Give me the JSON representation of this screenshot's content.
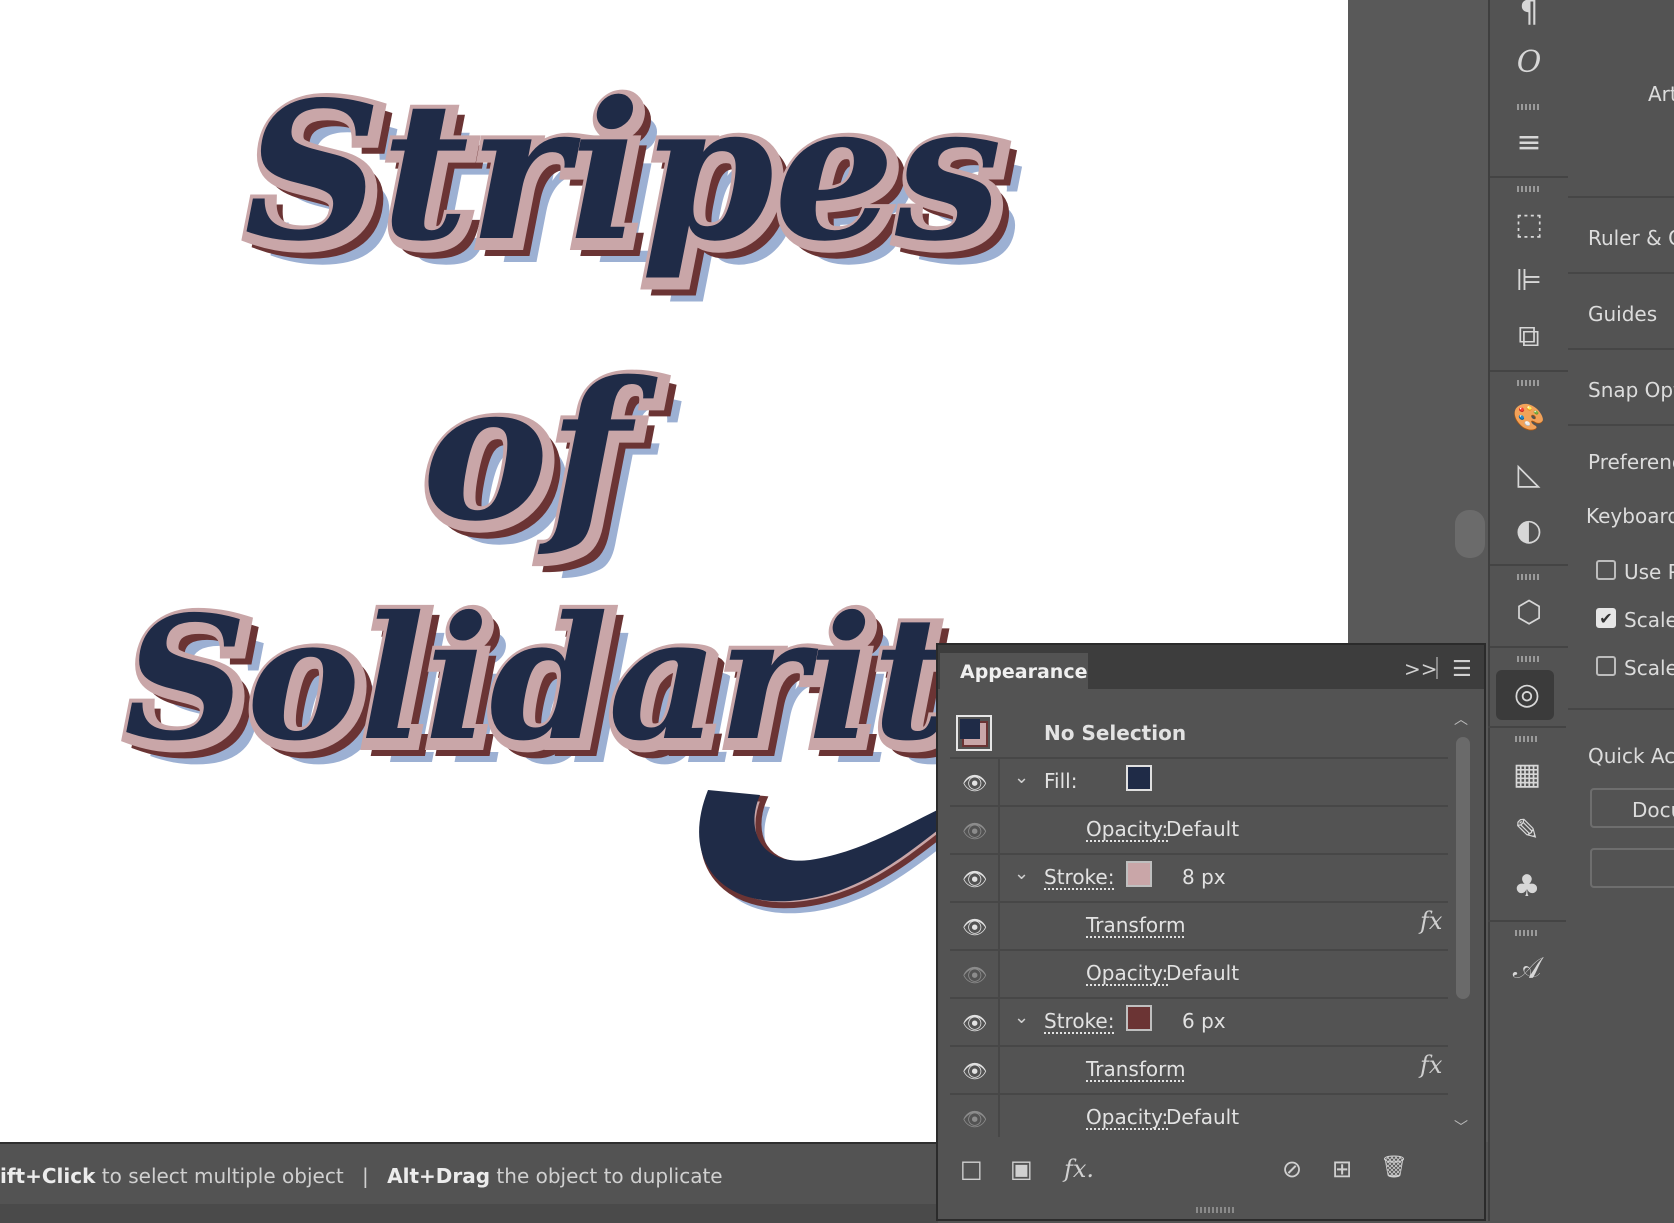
{
  "artwork": {
    "line1": "Stripes",
    "line2": "of",
    "line3": "Solidarity",
    "colors": {
      "fill": "#1f2b47",
      "stroke_light": "#c9a6a8",
      "stroke_dark": "#6b3434",
      "shadow": "#9cb0d3"
    }
  },
  "toolbar": {
    "icons": [
      "paragraph-icon",
      "opentype-icon",
      "align-lines-icon",
      "transform-icon",
      "align-icon",
      "pathfinder-icon",
      "color-palette-icon",
      "gradient-icon",
      "transparency-icon",
      "3d-cube-icon",
      "appearance-icon",
      "swatches-icon",
      "brushes-icon",
      "symbols-icon",
      "character-styles-icon"
    ],
    "glyphs": [
      "¶",
      "O",
      "≡",
      "⬚",
      "⊫",
      "⧉",
      "🎨",
      "◺",
      "◐",
      "⬡",
      "◎",
      "▦",
      "✎",
      "♣",
      "𝒜"
    ]
  },
  "properties": {
    "artboards_label": "Art",
    "ruler_label": "Ruler & G",
    "guides_label": "Guides",
    "snap_label": "Snap Opti",
    "preferences_label": "Preferenc",
    "keyboard_label": "Keyboard",
    "use_preview_label": "Use P",
    "scale_corners_label": "Scale",
    "scale_strokes_label": "Scale",
    "quick_actions_label": "Quick Act",
    "document_button": "Docu"
  },
  "status": {
    "shift_click": "ift+Click",
    "shift_click_text": " to select multiple object",
    "divider": "|",
    "alt_drag": "Alt+Drag",
    "alt_drag_text": " the object to duplicate"
  },
  "appearance": {
    "tab_title": "Appearance",
    "expand_glyph": ">>",
    "menu_glyph": "☰",
    "selection_label": "No Selection",
    "rows": {
      "fill_label": "Fill:",
      "fill_color": "#1f2b47",
      "opacity1_label": "Opacity:",
      "opacity1_value": "Default",
      "stroke1_label": "Stroke:",
      "stroke1_color": "#c9a6a8",
      "stroke1_value": "8 px",
      "transform1_label": "Transform",
      "opacity2_label": "Opacity:",
      "opacity2_value": "Default",
      "stroke2_label": "Stroke:",
      "stroke2_color": "#6b3434",
      "stroke2_value": "6 px",
      "transform2_label": "Transform",
      "opacity3_label": "Opacity:",
      "opacity3_value": "Default",
      "fx_glyph": "fx"
    },
    "footer": {
      "add_stroke": "□",
      "add_fill": "▣",
      "fx": "fx.",
      "clear": "⊘",
      "duplicate": "⊞",
      "delete": "🗑"
    }
  }
}
